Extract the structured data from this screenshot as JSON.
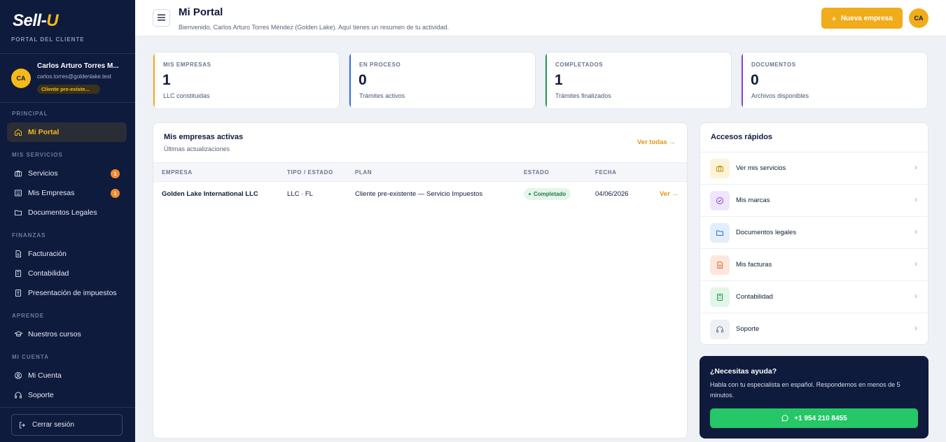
{
  "brand": {
    "logo_main": "Sell-",
    "logo_accent": "U",
    "portal_label": "PORTAL DEL CLIENTE"
  },
  "user": {
    "initials": "CA",
    "name": "Carlos Arturo Torres M...",
    "email": "carlos.torres@goldenlake.test",
    "badge": "Cliente pre-existe..."
  },
  "sidebar": {
    "sections": [
      {
        "title": "PRINCIPAL"
      },
      {
        "title": "MIS SERVICIOS"
      },
      {
        "title": "FINANZAS"
      },
      {
        "title": "APRENDE"
      },
      {
        "title": "MI CUENTA"
      }
    ],
    "items": [
      {
        "label": "Mi Portal",
        "icon": "home-icon",
        "active": true
      },
      {
        "label": "Servicios",
        "icon": "briefcase-icon",
        "badge": "1"
      },
      {
        "label": "Mis Empresas",
        "icon": "building-icon",
        "badge": "1"
      },
      {
        "label": "Documentos Legales",
        "icon": "folder-icon"
      },
      {
        "label": "Facturación",
        "icon": "file-icon"
      },
      {
        "label": "Contabilidad",
        "icon": "calculator-icon"
      },
      {
        "label": "Presentación de impuestos",
        "icon": "tax-icon"
      },
      {
        "label": "Nuestros cursos",
        "icon": "graduation-cap-icon"
      },
      {
        "label": "Mi Cuenta",
        "icon": "user-circle-icon"
      },
      {
        "label": "Soporte",
        "icon": "headset-icon"
      }
    ],
    "logout_label": "Cerrar sesión"
  },
  "header": {
    "title": "Mi Portal",
    "subtitle": "Bienvenido, Carlos Arturo Torres Méndez (Golden Lake). Aquí tienes un resumen de tu actividad.",
    "new_button": "Nueva empresa",
    "avatar_initials": "CA"
  },
  "stats": [
    {
      "label": "MIS EMPRESAS",
      "value": "1",
      "desc": "LLC constituidas",
      "color": "#f0ac1a"
    },
    {
      "label": "EN PROCESO",
      "value": "0",
      "desc": "Trámites activos",
      "color": "#2f6fd6"
    },
    {
      "label": "COMPLETADOS",
      "value": "1",
      "desc": "Trámites finalizados",
      "color": "#1f9a55"
    },
    {
      "label": "DOCUMENTOS",
      "value": "0",
      "desc": "Archivos disponibles",
      "color": "#8b3fd9"
    }
  ],
  "companies": {
    "title": "Mis empresas activas",
    "subtitle": "Últimas actualizaciones",
    "view_all": "Ver todas →",
    "columns": [
      "EMPRESA",
      "TIPO / ESTADO",
      "PLAN",
      "ESTADO",
      "FECHA"
    ],
    "rows": [
      {
        "empresa": "Golden Lake International LLC",
        "tipo": "LLC · FL",
        "plan": "Cliente pre-existente — Servicio Impuestos",
        "estado": "Completado",
        "fecha": "04/06/2026",
        "action": "Ver →"
      }
    ]
  },
  "quick_access": {
    "title": "Accesos rápidos",
    "items": [
      {
        "label": "Ver mis servicios",
        "icon": "briefcase-icon",
        "bg": "#fdf3d9",
        "fg": "#c98c0a"
      },
      {
        "label": "Mis marcas",
        "icon": "badge-check-icon",
        "bg": "#efe6fb",
        "fg": "#8b3fd9"
      },
      {
        "label": "Documentos legales",
        "icon": "folder-icon",
        "bg": "#e3eefc",
        "fg": "#2f6fd6"
      },
      {
        "label": "Mis facturas",
        "icon": "receipt-icon",
        "bg": "#fde6dc",
        "fg": "#e0642c"
      },
      {
        "label": "Contabilidad",
        "icon": "calculator-icon",
        "bg": "#e2f5e9",
        "fg": "#1f9a55"
      },
      {
        "label": "Soporte",
        "icon": "headset-icon",
        "bg": "#eef0f4",
        "fg": "#6a7390"
      }
    ]
  },
  "help": {
    "title": "¿Necesitas ayuda?",
    "text": "Habla con tu especialista en español. Respondemos en menos de 5 minutos.",
    "phone": "+1 954 210 8455"
  }
}
